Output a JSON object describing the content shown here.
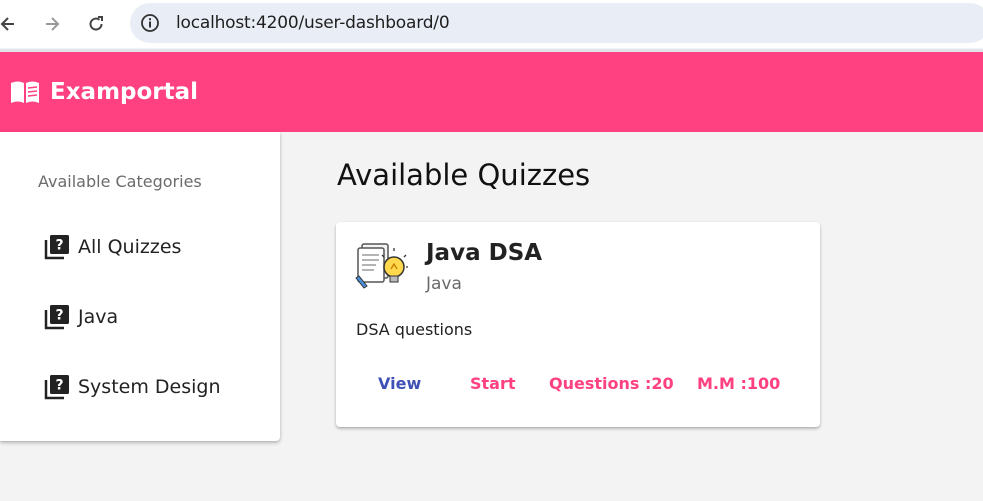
{
  "browser": {
    "url": "localhost:4200/user-dashboard/0",
    "icons": {
      "back": "arrow-left-icon",
      "forward": "arrow-right-icon",
      "reload": "reload-icon",
      "site_info": "info-icon"
    }
  },
  "header": {
    "brand": "Examportal",
    "background": "#ff4081",
    "logo_icon": "menu-book-icon"
  },
  "sidebar": {
    "subheader": "Available Categories",
    "items": [
      {
        "label": "All Quizzes",
        "icon": "quiz-icon"
      },
      {
        "label": "Java",
        "icon": "quiz-icon"
      },
      {
        "label": "System Design",
        "icon": "quiz-icon"
      }
    ]
  },
  "main": {
    "title": "Available Quizzes",
    "quizzes": [
      {
        "title": "Java DSA",
        "subtitle": "Java",
        "description": "DSA questions",
        "actions": {
          "view": "View",
          "start": "Start",
          "questions": "Questions :20",
          "marks": "M.M :100"
        }
      }
    ]
  },
  "colors": {
    "primary": "#3f51b5",
    "accent": "#ff4081"
  }
}
